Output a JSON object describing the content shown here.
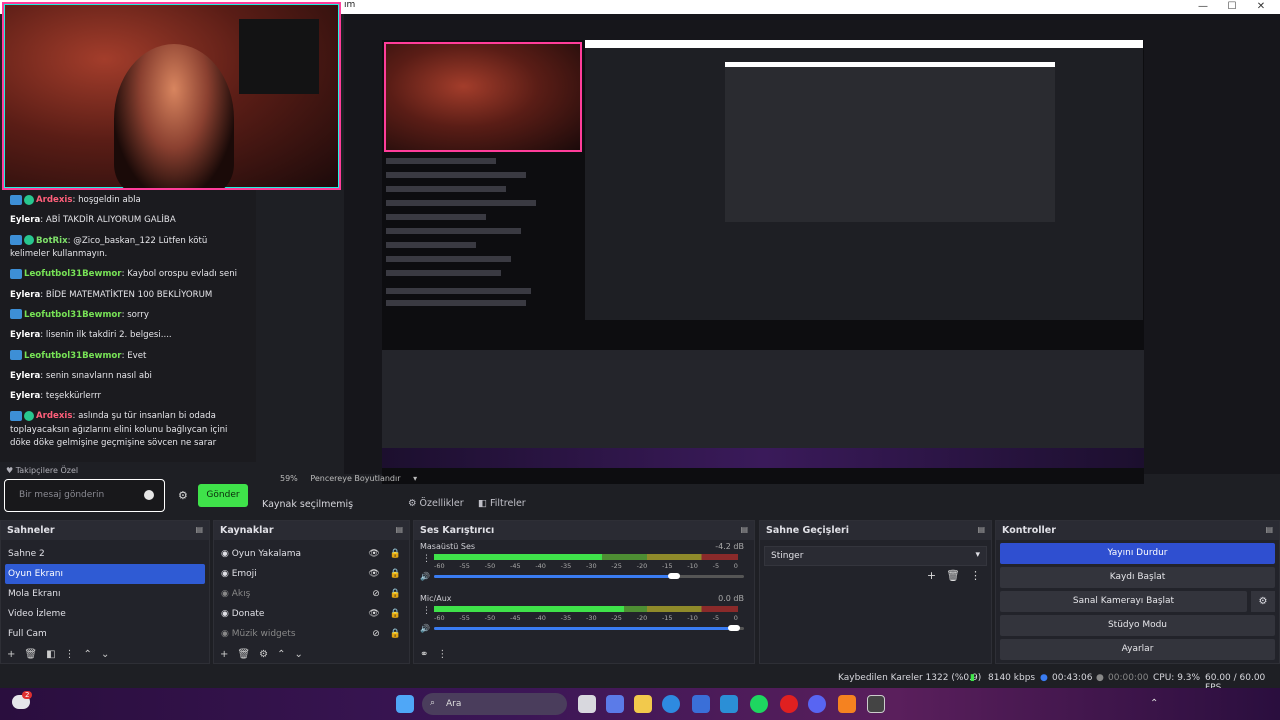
{
  "window": {
    "title_fragment": "ım",
    "minimize": "—",
    "maximize": "☐",
    "close": "✕"
  },
  "chat": {
    "messages": [
      {
        "user": "Ardexis",
        "text": ": hoşgeldin abla",
        "color": "red",
        "badges": 2
      },
      {
        "user": "Eylera",
        "text": ": ABİ TAKDİR ALIYORUM GALİBA",
        "color": "white",
        "badges": 0
      },
      {
        "user": "BotRix",
        "text": ": @Zico_baskan_122 Lütfen kötü kelimeler kullanmayın.",
        "color": "green",
        "badges": 2
      },
      {
        "user": "Leofutbol31Bewmor",
        "text": ": Kaybol orospu evladı seni",
        "color": "lime",
        "badges": 1
      },
      {
        "user": "Eylera",
        "text": ": BİDE MATEMATİKTEN 100 BEKLİYORUM",
        "color": "white",
        "badges": 0
      },
      {
        "user": "Leofutbol31Bewmor",
        "text": ": sorry",
        "color": "lime",
        "badges": 1
      },
      {
        "user": "Eylera",
        "text": ": lisenin ilk takdiri 2. belgesi....",
        "color": "white",
        "badges": 0
      },
      {
        "user": "Leofutbol31Bewmor",
        "text": ": Evet",
        "color": "lime",
        "badges": 1
      },
      {
        "user": "Eylera",
        "text": ": senin sınavların nasıl abi",
        "color": "white",
        "badges": 0
      },
      {
        "user": "Eylera",
        "text": ": teşekkürlerrr",
        "color": "white",
        "badges": 0
      },
      {
        "user": "Ardexis",
        "text": ": aslında şu tür insanları bi odada toplayacaksın ağızlarını elini kolunu bağlıycan içini döke döke gelmişine geçmişine sövcen ne sarar",
        "color": "red",
        "badges": 2
      }
    ],
    "followers_label": "♥ Takipçilere Özel",
    "input_placeholder": "Bir mesaj gönderin",
    "send_label": "Gönder"
  },
  "preview": {
    "zoom": "59%",
    "resize_label": "Pencereye Boyutlandır"
  },
  "source_toolbar": {
    "no_source": "Kaynak seçilmemiş",
    "properties": "Özellikler",
    "filters": "Filtreler"
  },
  "scenes": {
    "title": "Sahneler",
    "items": [
      "Sahne 2",
      "Oyun Ekranı",
      "Mola Ekranı",
      "Video İzleme",
      "Full Cam"
    ],
    "selected_index": 1
  },
  "sources": {
    "title": "Kaynaklar",
    "items": [
      {
        "label": "Oyun Yakalama",
        "visible": true
      },
      {
        "label": "Emoji",
        "visible": true
      },
      {
        "label": "Akış",
        "visible": false
      },
      {
        "label": "Donate",
        "visible": true
      },
      {
        "label": "Müzik widgets",
        "visible": false
      }
    ]
  },
  "mixer": {
    "title": "Ses Karıştırıcı",
    "channels": [
      {
        "name": "Masaüstü Ses",
        "db": "-4.2 dB",
        "level": 0.55,
        "volume": 0.8
      },
      {
        "name": "Mic/Aux",
        "db": "0.0 dB",
        "level": 0.62,
        "volume": 1.0
      }
    ],
    "ticks": [
      "-60",
      "-55",
      "-50",
      "-45",
      "-40",
      "-35",
      "-30",
      "-25",
      "-20",
      "-15",
      "-10",
      "-5",
      "0"
    ]
  },
  "transitions": {
    "title": "Sahne Geçişleri",
    "selected": "Stinger"
  },
  "controls": {
    "title": "Kontroller",
    "stop_stream": "Yayını Durdur",
    "start_recording": "Kaydı Başlat",
    "start_virtual_cam": "Sanal Kamerayı Başlat",
    "studio_mode": "Stüdyo Modu",
    "settings": "Ayarlar"
  },
  "status": {
    "dropped_frames": "Kaybedilen Kareler 1322 (%0.9)",
    "bitrate": "8140 kbps",
    "stream_time": "00:43:06",
    "rec_time": "00:00:00",
    "cpu": "CPU: 9.3%",
    "fps": "60.00 / 60.00 FPS"
  },
  "taskbar": {
    "search_placeholder": "Ara",
    "notification_count": "2"
  },
  "colors": {
    "accent": "#2f4fd0",
    "selected": "#2f5bd4",
    "send_green": "#3fe24a",
    "cam_border": "#ff3d9a"
  }
}
